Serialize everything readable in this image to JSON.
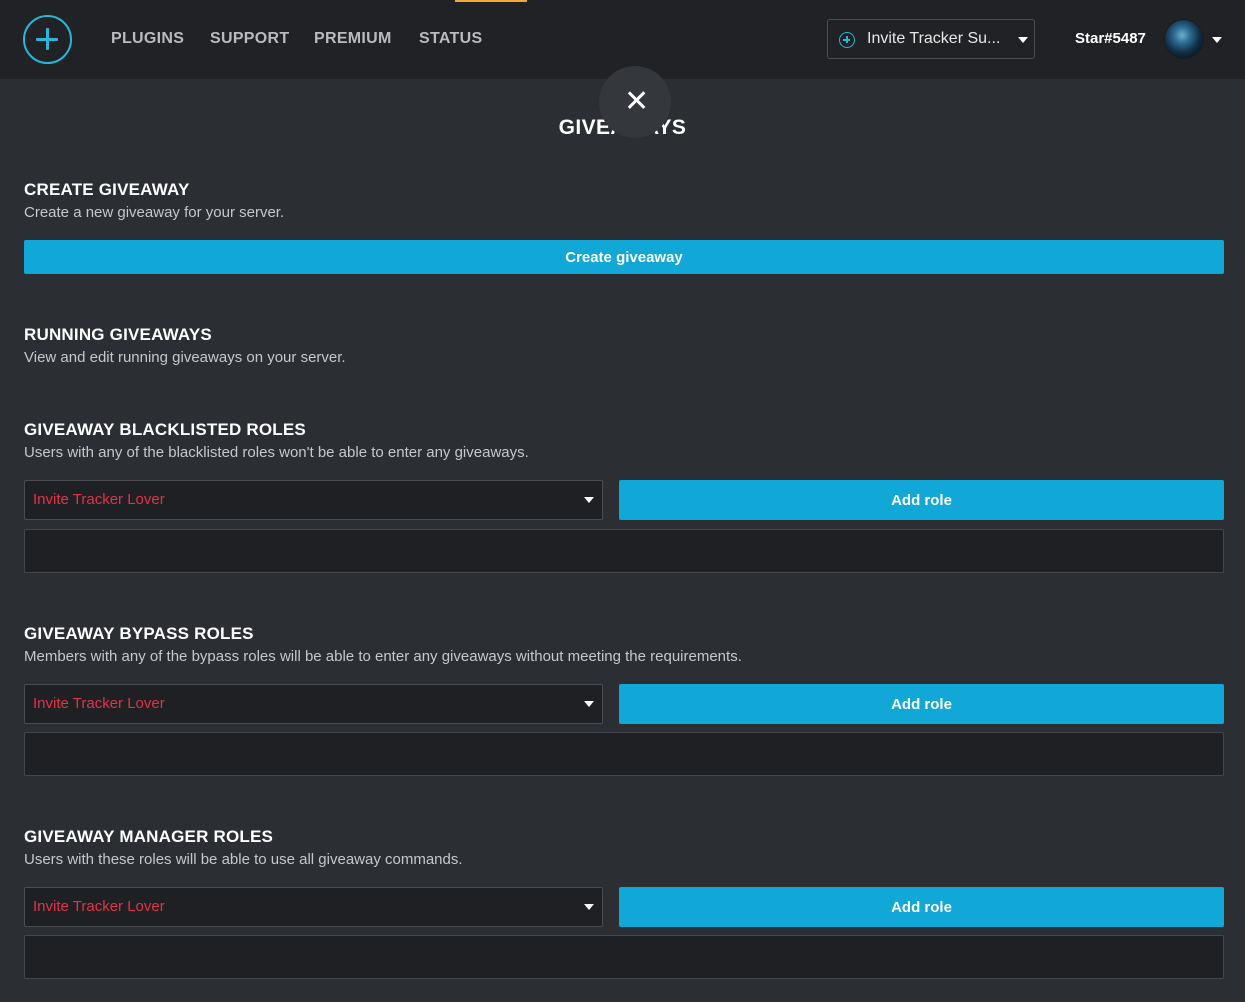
{
  "header": {
    "nav": [
      "PLUGINS",
      "SUPPORT",
      "PREMIUM",
      "STATUS"
    ],
    "server_name": "Invite Tracker Su...",
    "user_name": "Star#5487"
  },
  "page": {
    "title": "GIVEAWAYS",
    "close_symbol": "✕"
  },
  "sections": {
    "create": {
      "title": "CREATE GIVEAWAY",
      "description": "Create a new giveaway for your server.",
      "button": "Create giveaway"
    },
    "running": {
      "title": "RUNNING GIVEAWAYS",
      "description": "View and edit running giveaways on your server."
    },
    "blacklisted": {
      "title": "GIVEAWAY BLACKLISTED ROLES",
      "description": "Users with any of the blacklisted roles won't be able to enter any giveaways.",
      "selected_role": "Invite Tracker Lover",
      "button": "Add role"
    },
    "bypass": {
      "title": "GIVEAWAY BYPASS ROLES",
      "description": "Members with any of the bypass roles will be able to enter any giveaways without meeting the requirements.",
      "selected_role": "Invite Tracker Lover",
      "button": "Add role"
    },
    "manager": {
      "title": "GIVEAWAY MANAGER ROLES",
      "description": "Users with these roles will be able to use all giveaway commands.",
      "selected_role": "Invite Tracker Lover",
      "button": "Add role"
    }
  },
  "colors": {
    "accent": "#11a7d6",
    "logo": "#2ab6d6",
    "role_text": "#e23349",
    "background": "#2b2e32",
    "topbar": "#202225"
  },
  "icons": {
    "logo": "plus-circle-icon",
    "server": "plus-circle-icon",
    "dropdown": "caret-down-icon",
    "close": "close-icon"
  }
}
